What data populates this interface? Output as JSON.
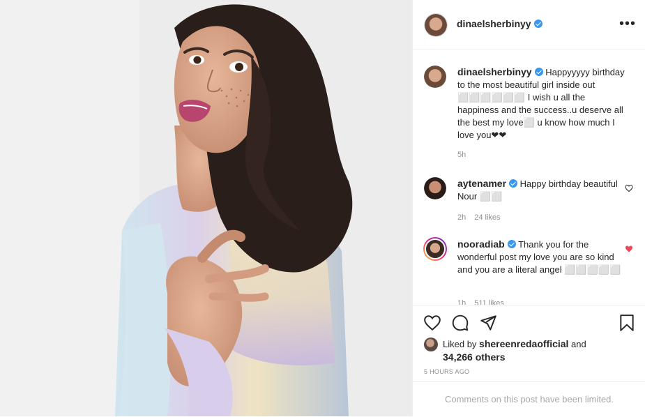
{
  "post": {
    "author": "dinaelsherbinyy",
    "more_label": "•••"
  },
  "caption": {
    "username": "dinaelsherbinyy",
    "text": "Happyyyyy birthday to the most beautiful girl inside out ⬜⬜⬜⬜⬜⬜ I wish u all the happiness and the success..u deserve all the best my love⬜ u know how much I love you❤❤",
    "time": "5h"
  },
  "comments": [
    {
      "username": "aytenamer",
      "text": "Happy birthday beautiful Nour ⬜⬜",
      "time": "2h",
      "likes": "24 likes",
      "liked": false
    },
    {
      "username": "nooradiab",
      "text": "Thank you for the wonderful post my love you are so kind and you are a literal angel ⬜⬜⬜⬜⬜",
      "time": "1h",
      "likes": "511 likes",
      "liked": true
    }
  ],
  "actions": {
    "like_icon": "heart-outline-icon",
    "comment_icon": "comment-bubble-icon",
    "share_icon": "paper-plane-icon",
    "save_icon": "bookmark-icon"
  },
  "likes_line": {
    "prefix": "Liked by ",
    "user": "shereenredaofficial",
    "suffix": " and",
    "count": "34,266 others"
  },
  "timestamp": "5 HOURS AGO",
  "comments_limited": "Comments on this post have been limited.",
  "colors": {
    "verified": "#3897f0",
    "liked_heart": "#ed4956",
    "muted": "#8e8e8e"
  }
}
